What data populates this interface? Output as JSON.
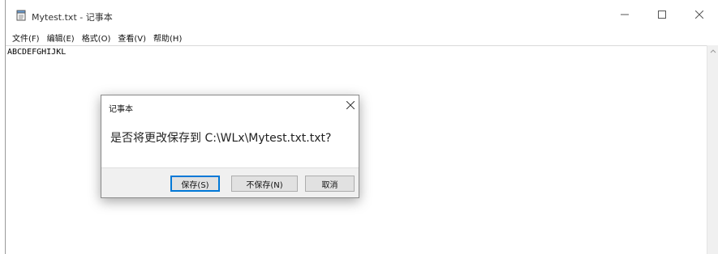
{
  "window": {
    "title": "Mytest.txt - 记事本",
    "icon": "notepad-icon"
  },
  "menu": {
    "items": [
      "文件(F)",
      "编辑(E)",
      "格式(O)",
      "查看(V)",
      "帮助(H)"
    ]
  },
  "editor": {
    "content": "ABCDEFGHIJKL"
  },
  "dialog": {
    "title": "记事本",
    "message": "是否将更改保存到 C:\\WLx\\Mytest.txt.txt?",
    "buttons": {
      "save": "保存(S)",
      "dont_save": "不保存(N)",
      "cancel": "取消"
    }
  }
}
